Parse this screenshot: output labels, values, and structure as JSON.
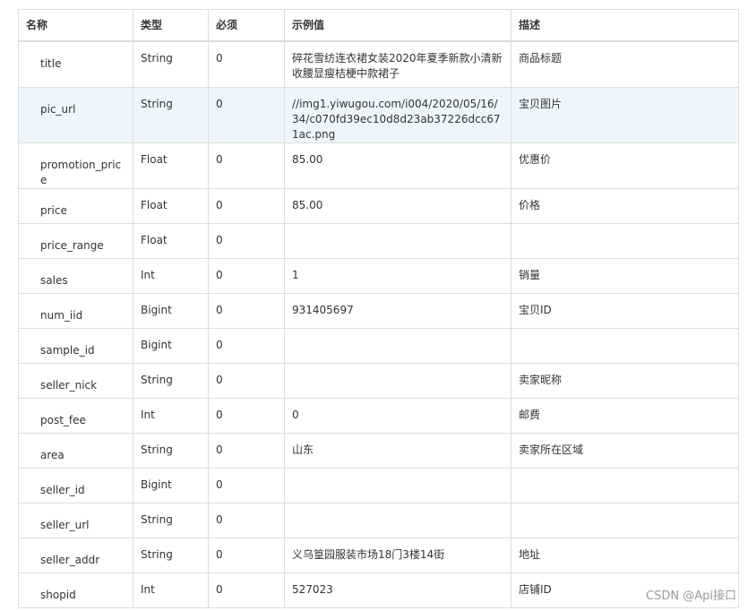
{
  "table": {
    "headers": [
      "名称",
      "类型",
      "必须",
      "示例值",
      "描述"
    ],
    "rows": [
      {
        "name": "title",
        "type": "String",
        "required": "0",
        "example": "碎花雪纺连衣裙女装2020年夏季新款小清新收腰显瘦桔梗中款裙子",
        "desc": "商品标题"
      },
      {
        "name": "pic_url",
        "type": "String",
        "required": "0",
        "example": "//img1.yiwugou.com/i004/2020/05/16/34/c070fd39ec10d8d23ab37226dcc671ac.png",
        "desc": "宝贝图片"
      },
      {
        "name": "promotion_price",
        "type": "Float",
        "required": "0",
        "example": "85.00",
        "desc": "优惠价"
      },
      {
        "name": "price",
        "type": "Float",
        "required": "0",
        "example": "85.00",
        "desc": "价格"
      },
      {
        "name": "price_range",
        "type": "Float",
        "required": "0",
        "example": "",
        "desc": ""
      },
      {
        "name": "sales",
        "type": "Int",
        "required": "0",
        "example": "1",
        "desc": "销量"
      },
      {
        "name": "num_iid",
        "type": "Bigint",
        "required": "0",
        "example": "931405697",
        "desc": "宝贝ID"
      },
      {
        "name": "sample_id",
        "type": "Bigint",
        "required": "0",
        "example": "",
        "desc": ""
      },
      {
        "name": "seller_nick",
        "type": "String",
        "required": "0",
        "example": "",
        "desc": "卖家昵称"
      },
      {
        "name": "post_fee",
        "type": "Int",
        "required": "0",
        "example": "0",
        "desc": "邮费"
      },
      {
        "name": "area",
        "type": "String",
        "required": "0",
        "example": "山东",
        "desc": "卖家所在区域"
      },
      {
        "name": "seller_id",
        "type": "Bigint",
        "required": "0",
        "example": "",
        "desc": ""
      },
      {
        "name": "seller_url",
        "type": "String",
        "required": "0",
        "example": "",
        "desc": ""
      },
      {
        "name": "seller_addr",
        "type": "String",
        "required": "0",
        "example": "义乌篁园服装市场18门3楼14街",
        "desc": "地址"
      },
      {
        "name": "shopid",
        "type": "Int",
        "required": "0",
        "example": "527023",
        "desc": "店铺ID"
      }
    ]
  },
  "watermark": "CSDN @Api接口"
}
